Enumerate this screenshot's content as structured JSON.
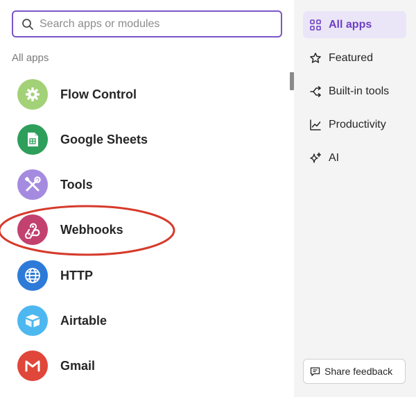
{
  "search": {
    "placeholder": "Search apps or modules"
  },
  "section_label": "All apps",
  "apps": [
    {
      "label": "Flow Control",
      "icon": "gear-icon",
      "color": "#a3d177"
    },
    {
      "label": "Google Sheets",
      "icon": "spreadsheet-icon",
      "color": "#2e9e5b"
    },
    {
      "label": "Tools",
      "icon": "wrench-screwdriver-icon",
      "color": "#a58be0"
    },
    {
      "label": "Webhooks",
      "icon": "webhook-icon",
      "color": "#c2416e"
    },
    {
      "label": "HTTP",
      "icon": "globe-icon",
      "color": "#2e7ad9"
    },
    {
      "label": "Airtable",
      "icon": "box-icon",
      "color": "#4db8f0"
    },
    {
      "label": "Gmail",
      "icon": "envelope-m-icon",
      "color": "#e0463a"
    }
  ],
  "nav": [
    {
      "label": "All apps",
      "icon": "grid-icon",
      "active": true
    },
    {
      "label": "Featured",
      "icon": "star-icon",
      "active": false
    },
    {
      "label": "Built-in tools",
      "icon": "split-arrow-icon",
      "active": false
    },
    {
      "label": "Productivity",
      "icon": "chart-line-icon",
      "active": false
    },
    {
      "label": "AI",
      "icon": "sparkle-icon",
      "active": false
    }
  ],
  "feedback_button": {
    "label": "Share feedback",
    "icon": "comment-icon"
  },
  "colors": {
    "accent": "#6d3fc4",
    "highlight_annotation": "#d63a2b"
  }
}
